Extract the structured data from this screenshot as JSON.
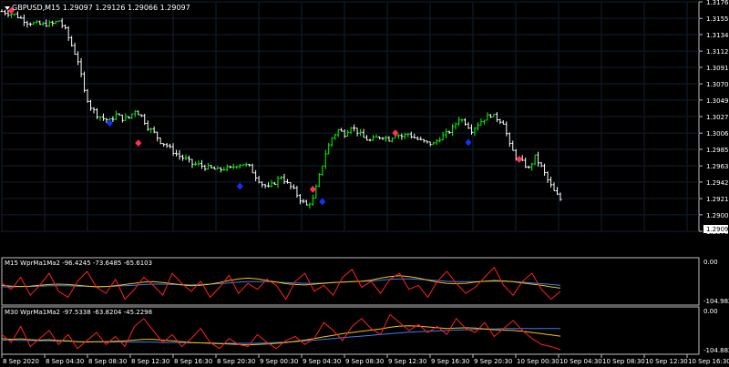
{
  "window": {
    "symbol_header": "GBPUSD,M15  1.29097 1.29126 1.29066 1.29097"
  },
  "colors": {
    "background": "#000000",
    "grid": "#0f1f2f",
    "bull_bar": "#00ff00",
    "bear_bar": "#ffffff",
    "marker_sell": "#ff3050",
    "marker_buy": "#1030ff",
    "wpr_line": "#ff2020",
    "ma1_line": "#ffc000",
    "ma2_line": "#3080ff",
    "price_tag_bg": "#ffffff",
    "price_tag_fg": "#000000"
  },
  "price_axis": {
    "ticks": [
      "1.31765",
      "1.31550",
      "1.31340",
      "1.31125",
      "1.30915",
      "1.30700",
      "1.30490",
      "1.30275",
      "1.30060",
      "1.29850",
      "1.29635",
      "1.29425",
      "1.29210",
      "1.29000",
      "1.28785"
    ],
    "current_price_tag": "1.29097"
  },
  "time_axis": {
    "labels": [
      "8 Sep 2020",
      "8 Sep 04:30",
      "8 Sep 08:30",
      "8 Sep 12:30",
      "8 Sep 16:30",
      "8 Sep 20:30",
      "9 Sep 00:30",
      "9 Sep 04:30",
      "9 Sep 08:30",
      "9 Sep 12:30",
      "9 Sep 16:30",
      "9 Sep 20:30",
      "10 Sep 00:30",
      "10 Sep 04:30",
      "10 Sep 08:30",
      "10 Sep 12:30",
      "10 Sep 16:30"
    ]
  },
  "indicators": [
    {
      "header": "M15 WprMa1Ma2 -96.4245 -73.6485 -65.6103",
      "axis_top": "0.00",
      "axis_bottom": "-104.9825"
    },
    {
      "header": "M30 WprMa1Ma2 -97.5338 -63.8204 -45.2298",
      "axis_top": "0.00",
      "axis_bottom": "-104.8825"
    }
  ],
  "chart_data": {
    "type": "bar",
    "symbol": "GBPUSD",
    "timeframe": "M15",
    "ylim": [
      1.28785,
      1.31765
    ],
    "close_path": [
      [
        0,
        1.3164
      ],
      [
        4,
        1.316
      ],
      [
        8,
        1.315
      ],
      [
        12,
        1.3147
      ],
      [
        16,
        1.3148
      ],
      [
        18,
        1.3152
      ],
      [
        20,
        1.314
      ],
      [
        22,
        1.312
      ],
      [
        24,
        1.31
      ],
      [
        26,
        1.306
      ],
      [
        28,
        1.304
      ],
      [
        30,
        1.303
      ],
      [
        32,
        1.3025
      ],
      [
        34,
        1.3022
      ],
      [
        36,
        1.303
      ],
      [
        38,
        1.3025
      ],
      [
        40,
        1.3026
      ],
      [
        42,
        1.3036
      ],
      [
        44,
        1.3028
      ],
      [
        46,
        1.3014
      ],
      [
        48,
        1.3006
      ],
      [
        50,
        1.2995
      ],
      [
        52,
        1.299
      ],
      [
        54,
        1.2982
      ],
      [
        56,
        1.2976
      ],
      [
        58,
        1.2972
      ],
      [
        60,
        1.2966
      ],
      [
        62,
        1.2965
      ],
      [
        64,
        1.2962
      ],
      [
        66,
        1.296
      ],
      [
        68,
        1.2958
      ],
      [
        70,
        1.296
      ],
      [
        72,
        1.296
      ],
      [
        74,
        1.2965
      ],
      [
        76,
        1.2966
      ],
      [
        78,
        1.2962
      ],
      [
        80,
        1.295
      ],
      [
        82,
        1.294
      ],
      [
        84,
        1.2935
      ],
      [
        86,
        1.2942
      ],
      [
        88,
        1.295
      ],
      [
        90,
        1.294
      ],
      [
        92,
        1.2932
      ],
      [
        94,
        1.292
      ],
      [
        96,
        1.2912
      ],
      [
        98,
        1.292
      ],
      [
        100,
        1.295
      ],
      [
        102,
        1.298
      ],
      [
        104,
        1.3
      ],
      [
        106,
        1.301
      ],
      [
        108,
        1.3005
      ],
      [
        110,
        1.3015
      ],
      [
        112,
        1.3008
      ],
      [
        114,
        1.3
      ],
      [
        116,
        1.2996
      ],
      [
        118,
        1.3
      ],
      [
        120,
        1.3002
      ],
      [
        122,
        1.2998
      ],
      [
        124,
        1.3005
      ],
      [
        126,
        1.3002
      ],
      [
        128,
        1.3005
      ],
      [
        130,
        1.3
      ],
      [
        132,
        1.2996
      ],
      [
        134,
        1.2993
      ],
      [
        136,
        1.2992
      ],
      [
        138,
        1.3
      ],
      [
        140,
        1.3005
      ],
      [
        142,
        1.3012
      ],
      [
        144,
        1.3025
      ],
      [
        146,
        1.302
      ],
      [
        148,
        1.301
      ],
      [
        150,
        1.3018
      ],
      [
        152,
        1.3025
      ],
      [
        154,
        1.303
      ],
      [
        156,
        1.3025
      ],
      [
        158,
        1.302
      ],
      [
        160,
        1.299
      ],
      [
        162,
        1.2975
      ],
      [
        164,
        1.2968
      ],
      [
        166,
        1.296
      ],
      [
        168,
        1.2975
      ],
      [
        170,
        1.2962
      ],
      [
        172,
        1.2945
      ],
      [
        174,
        1.293
      ],
      [
        176,
        1.292
      ]
    ],
    "signals": [
      {
        "type": "sell",
        "t": 3,
        "price": 1.3165
      },
      {
        "type": "buy",
        "t": 34,
        "price": 1.3019
      },
      {
        "type": "sell",
        "t": 43,
        "price": 1.2993
      },
      {
        "type": "buy",
        "t": 75,
        "price": 1.2937
      },
      {
        "type": "sell",
        "t": 98,
        "price": 1.2933
      },
      {
        "type": "buy",
        "t": 101,
        "price": 1.2917
      },
      {
        "type": "sell",
        "t": 124,
        "price": 1.3006
      },
      {
        "type": "buy",
        "t": 147,
        "price": 1.2994
      },
      {
        "type": "sell",
        "t": 163,
        "price": 1.2972
      }
    ],
    "indicator_panels": [
      {
        "name": "M15 WprMa1Ma2",
        "ylim": [
          -104.9825,
          0
        ],
        "wpr": [
          -55,
          -70,
          -40,
          -85,
          -60,
          -30,
          -75,
          -90,
          -50,
          -25,
          -65,
          -80,
          -45,
          -95,
          -70,
          -40,
          -60,
          -85,
          -30,
          -55,
          -75,
          -50,
          -90,
          -65,
          -35,
          -80,
          -55,
          -70,
          -45,
          -60,
          -95,
          -50,
          -30,
          -75,
          -60,
          -85,
          -40,
          -20,
          -65,
          -50,
          -80,
          -45,
          -30,
          -70,
          -60,
          -90,
          -50,
          -25,
          -55,
          -80,
          -65,
          -40,
          -15,
          -60,
          -85,
          -50,
          -30,
          -70,
          -95,
          -75
        ],
        "ma1": [
          -60,
          -62,
          -63,
          -62,
          -60,
          -58,
          -57,
          -58,
          -60,
          -62,
          -64,
          -63,
          -61,
          -58,
          -55,
          -52,
          -51,
          -53,
          -56,
          -59,
          -61,
          -60,
          -57,
          -53,
          -48,
          -44,
          -42,
          -44,
          -48,
          -52,
          -56,
          -58,
          -59,
          -57,
          -55,
          -53,
          -52,
          -51,
          -50,
          -47,
          -42,
          -38,
          -36,
          -38,
          -42,
          -47,
          -52,
          -55,
          -56,
          -55,
          -52,
          -50,
          -48,
          -49,
          -51,
          -54,
          -57,
          -60,
          -64,
          -67
        ],
        "ma2": [
          -64,
          -64,
          -63,
          -63,
          -62,
          -61,
          -61,
          -61,
          -62,
          -62,
          -63,
          -63,
          -62,
          -61,
          -60,
          -58,
          -57,
          -57,
          -58,
          -58,
          -59,
          -58,
          -57,
          -56,
          -54,
          -52,
          -51,
          -51,
          -51,
          -52,
          -53,
          -54,
          -55,
          -55,
          -54,
          -53,
          -52,
          -51,
          -50,
          -49,
          -47,
          -45,
          -44,
          -44,
          -45,
          -46,
          -48,
          -50,
          -51,
          -51,
          -51,
          -50,
          -50,
          -50,
          -51,
          -52,
          -54,
          -56,
          -58,
          -60
        ]
      },
      {
        "name": "M30 WprMa1Ma2",
        "ylim": [
          -104.8825,
          0
        ],
        "wpr": [
          -60,
          -80,
          -40,
          -90,
          -70,
          -50,
          -85,
          -60,
          -95,
          -75,
          -55,
          -85,
          -65,
          -90,
          -40,
          -20,
          -50,
          -80,
          -60,
          -90,
          -70,
          -45,
          -80,
          -95,
          -70,
          -85,
          -90,
          -60,
          -80,
          -95,
          -75,
          -65,
          -85,
          -70,
          -30,
          -50,
          -75,
          -40,
          -20,
          -45,
          -60,
          -10,
          -30,
          -50,
          -35,
          -55,
          -40,
          -60,
          -20,
          -45,
          -55,
          -30,
          -65,
          -45,
          -25,
          -50,
          -70,
          -85,
          -90,
          -98
        ],
        "ma1": [
          -70,
          -72,
          -71,
          -73,
          -74,
          -73,
          -75,
          -76,
          -78,
          -79,
          -78,
          -78,
          -77,
          -76,
          -74,
          -72,
          -72,
          -74,
          -76,
          -78,
          -80,
          -81,
          -82,
          -83,
          -84,
          -85,
          -86,
          -85,
          -84,
          -82,
          -80,
          -77,
          -74,
          -70,
          -66,
          -62,
          -58,
          -55,
          -52,
          -49,
          -46,
          -42,
          -39,
          -38,
          -39,
          -41,
          -43,
          -45,
          -44,
          -43,
          -44,
          -46,
          -48,
          -49,
          -50,
          -52,
          -55,
          -58,
          -61,
          -64
        ],
        "ma2": [
          -74,
          -74,
          -75,
          -75,
          -76,
          -76,
          -77,
          -77,
          -78,
          -78,
          -78,
          -79,
          -79,
          -79,
          -79,
          -79,
          -79,
          -80,
          -80,
          -80,
          -81,
          -81,
          -81,
          -82,
          -82,
          -82,
          -82,
          -82,
          -81,
          -80,
          -79,
          -78,
          -76,
          -74,
          -72,
          -70,
          -68,
          -66,
          -64,
          -62,
          -60,
          -58,
          -56,
          -54,
          -53,
          -52,
          -51,
          -50,
          -49,
          -48,
          -47,
          -46,
          -46,
          -45,
          -45,
          -45,
          -45,
          -45,
          -45,
          -45
        ]
      }
    ]
  }
}
